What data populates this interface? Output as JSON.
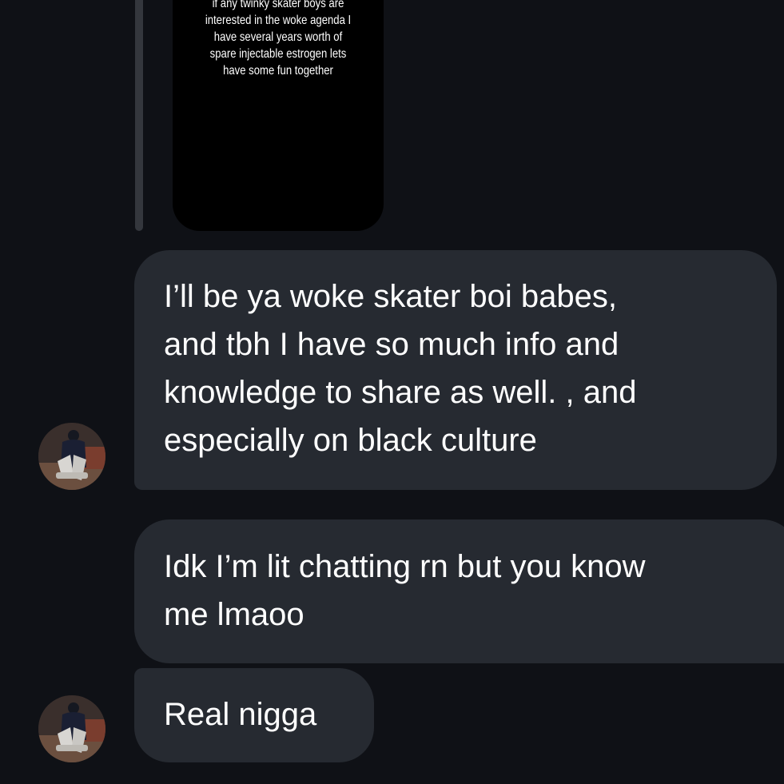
{
  "story": {
    "lines": [
      "if any twinky skater boys are",
      "interested in the woke agenda I",
      "have several years worth of",
      "spare injectable estrogen lets",
      "have some fun together"
    ]
  },
  "messages": [
    {
      "lines": [
        "I’ll be ya woke skater boi babes,",
        "and tbh I have so much info and",
        "knowledge to share as well. , and",
        "especially on black culture"
      ]
    },
    {
      "lines": [
        "Idk I’m lit chatting rn but you know",
        "me lmaoo"
      ]
    },
    {
      "lines": [
        "Real nigga"
      ]
    }
  ],
  "colors": {
    "background": "#0f1116",
    "bubble": "#262a31",
    "story_card": "#000000",
    "text": "#ffffff"
  }
}
